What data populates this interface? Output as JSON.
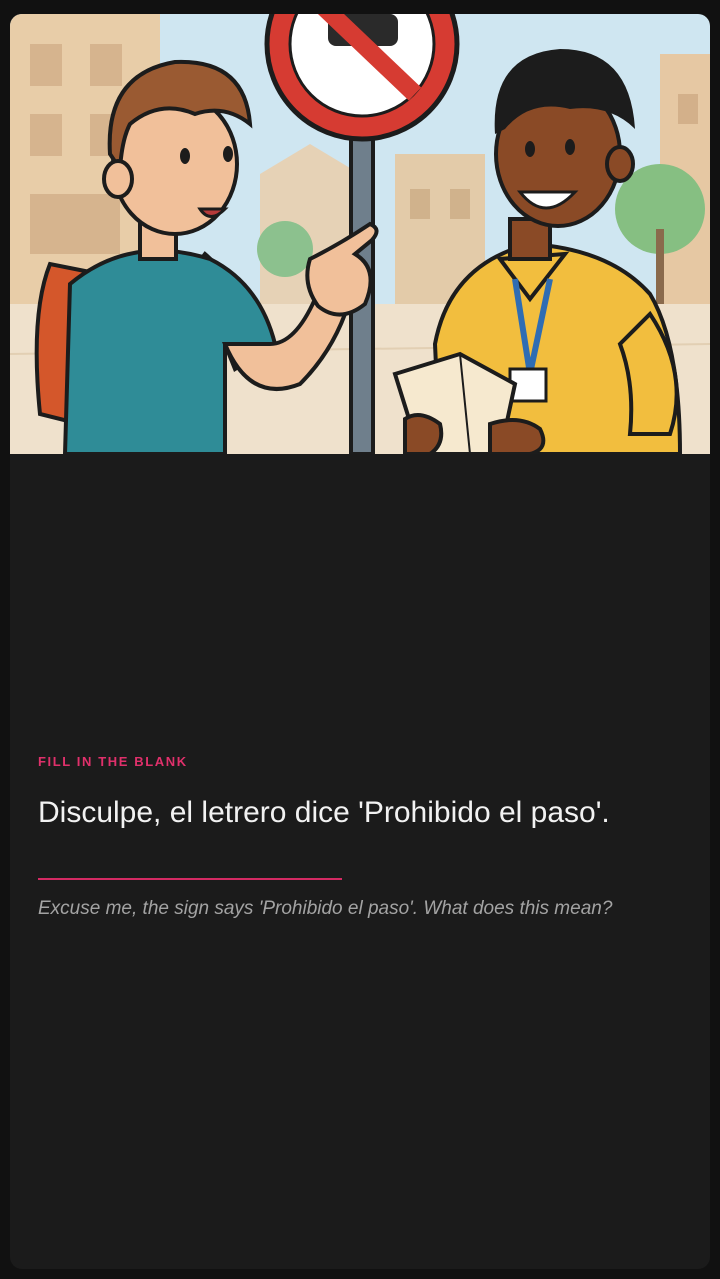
{
  "card": {
    "illustration_alt": "",
    "prompt_type": "FILL IN THE BLANK",
    "sentence": "Disculpe, el letrero dice 'Prohibido el paso'.",
    "translation": "Excuse me, the sign says 'Prohibido el paso'. What does this mean?"
  },
  "colors": {
    "accent": "#e0306b",
    "background": "#1b1b1b",
    "text_primary": "#f2f2f2",
    "text_secondary": "#a3a3a3"
  }
}
